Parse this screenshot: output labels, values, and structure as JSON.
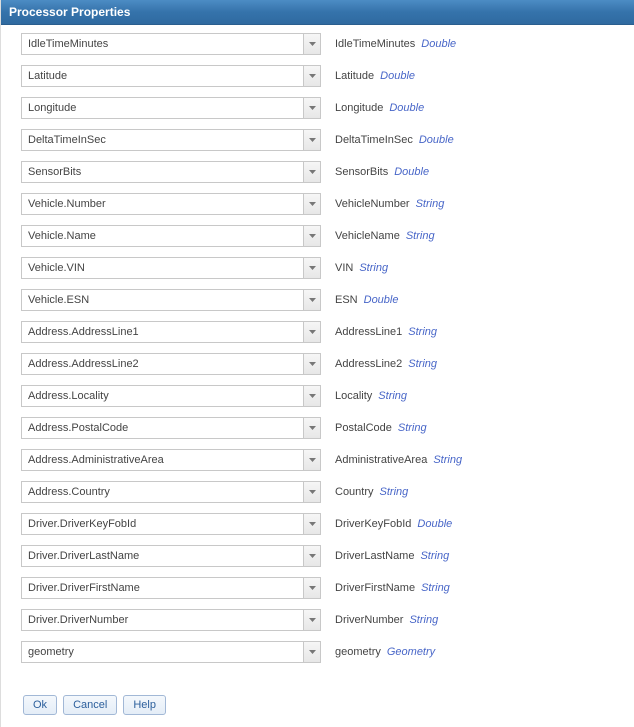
{
  "title": "Processor Properties",
  "rows": [
    {
      "value": "IdleTimeMinutes",
      "label": "IdleTimeMinutes",
      "type": "Double"
    },
    {
      "value": "Latitude",
      "label": "Latitude",
      "type": "Double"
    },
    {
      "value": "Longitude",
      "label": "Longitude",
      "type": "Double"
    },
    {
      "value": "DeltaTimeInSec",
      "label": "DeltaTimeInSec",
      "type": "Double"
    },
    {
      "value": "SensorBits",
      "label": "SensorBits",
      "type": "Double"
    },
    {
      "value": "Vehicle.Number",
      "label": "VehicleNumber",
      "type": "String"
    },
    {
      "value": "Vehicle.Name",
      "label": "VehicleName",
      "type": "String"
    },
    {
      "value": "Vehicle.VIN",
      "label": "VIN",
      "type": "String"
    },
    {
      "value": "Vehicle.ESN",
      "label": "ESN",
      "type": "Double"
    },
    {
      "value": "Address.AddressLine1",
      "label": "AddressLine1",
      "type": "String"
    },
    {
      "value": "Address.AddressLine2",
      "label": "AddressLine2",
      "type": "String"
    },
    {
      "value": "Address.Locality",
      "label": "Locality",
      "type": "String"
    },
    {
      "value": "Address.PostalCode",
      "label": "PostalCode",
      "type": "String"
    },
    {
      "value": "Address.AdministrativeArea",
      "label": "AdministrativeArea",
      "type": "String"
    },
    {
      "value": "Address.Country",
      "label": "Country",
      "type": "String"
    },
    {
      "value": "Driver.DriverKeyFobId",
      "label": "DriverKeyFobId",
      "type": "Double"
    },
    {
      "value": "Driver.DriverLastName",
      "label": "DriverLastName",
      "type": "String"
    },
    {
      "value": "Driver.DriverFirstName",
      "label": "DriverFirstName",
      "type": "String"
    },
    {
      "value": "Driver.DriverNumber",
      "label": "DriverNumber",
      "type": "String"
    },
    {
      "value": "geometry",
      "label": "geometry",
      "type": "Geometry"
    }
  ],
  "buttons": {
    "ok": "Ok",
    "cancel": "Cancel",
    "help": "Help"
  }
}
